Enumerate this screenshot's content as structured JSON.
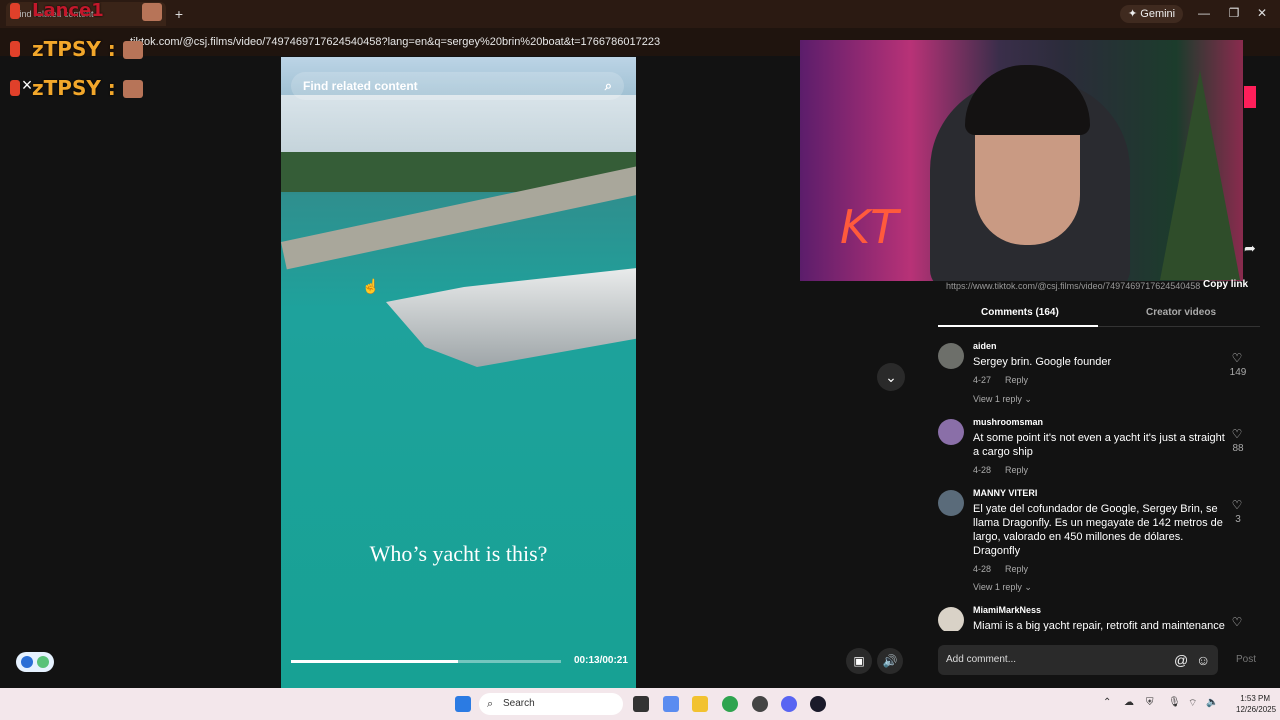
{
  "browser": {
    "tab_title": "Find related content",
    "new_tab": "+",
    "gemini_label": "Gemini",
    "url": "tiktok.com/@csj.films/video/7497469717624540458?lang=en&q=sergey%20brin%20boat&t=1766786017223"
  },
  "overlay": {
    "chat_name_1": "Lance1",
    "chat_name_2": "zTPSY :",
    "chat_name_3": "zTPSY :",
    "close": "×"
  },
  "video": {
    "search_placeholder": "Find related content",
    "caption": "Who’s yacht is this?",
    "timecode": "00:13/00:21",
    "progress_fraction": 0.62
  },
  "panel": {
    "link_text": "https://www.tiktok.com/@csj.films/video/7497469717624540458",
    "copy_link": "Copy link",
    "tab_comments": "Comments (164)",
    "tab_creator": "Creator videos",
    "comment_placeholder": "Add comment...",
    "post": "Post"
  },
  "comments": [
    {
      "user": "aiden",
      "text": "Sergey brin. Google founder",
      "date": "4-27",
      "reply": "Reply",
      "replies": "View 1 reply",
      "likes": "149",
      "avatar_color": "#6d6f6a"
    },
    {
      "user": "mushroomsman",
      "text": "At some point it's not even a yacht it's just a straight a cargo ship",
      "date": "4-28",
      "reply": "Reply",
      "replies": "",
      "likes": "88",
      "avatar_color": "#8a6fa8"
    },
    {
      "user": "MANNY VITERI",
      "text": "El yate del cofundador de Google, Sergey Brin, se llama Dragonfly. Es un megayate de 142 metros de largo, valorado en 450 millones de dólares. Dragonfly",
      "date": "4-28",
      "reply": "Reply",
      "replies": "View 1 reply",
      "likes": "3",
      "avatar_color": "#5a6b7a"
    },
    {
      "user": "MiamiMarkNess",
      "text": "Miami is a big yacht repair, retrofit and maintenance",
      "date": "",
      "reply": "",
      "replies": "",
      "likes": "",
      "avatar_color": "#d9d2c7"
    }
  ],
  "taskbar": {
    "search": "Search",
    "time": "1:53 PM",
    "date": "12/26/2025"
  },
  "colors": {
    "accent_orange": "#f2a72b",
    "taskbar_bg": "#f3e7eb",
    "panel_bg": "#121212"
  }
}
